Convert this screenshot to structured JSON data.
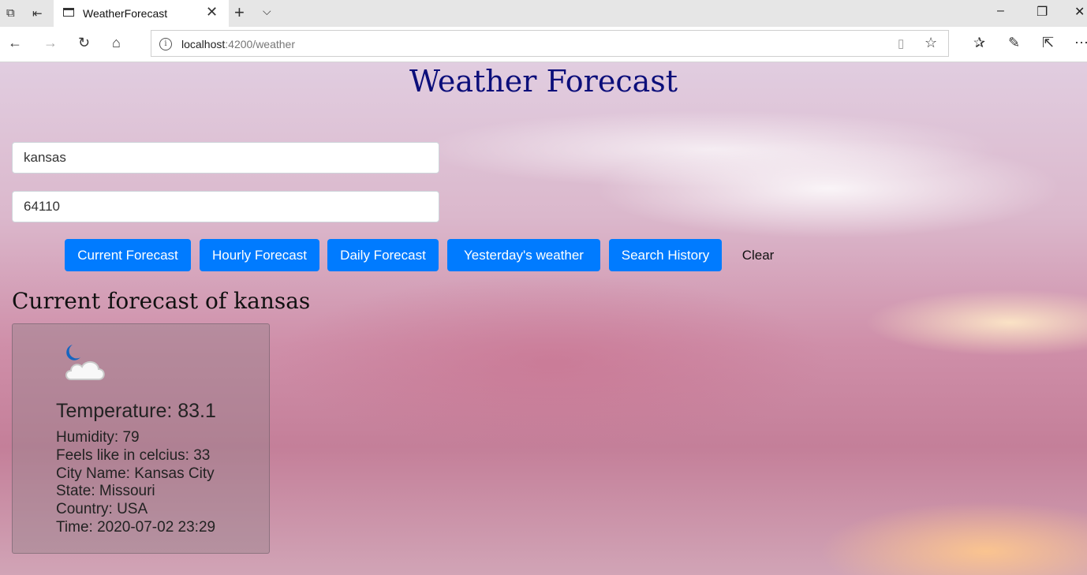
{
  "browser": {
    "tab_title": "WeatherForecast",
    "url_host": "localhost",
    "url_rest": ":4200/weather"
  },
  "page": {
    "title": "Weather Forecast",
    "city_input": {
      "value": "kansas"
    },
    "zip_input": {
      "value": "64110"
    },
    "buttons": {
      "current": "Current Forecast",
      "hourly": "Hourly Forecast",
      "daily": "Daily Forecast",
      "yesterday": "Yesterday's weather",
      "history": "Search History",
      "clear": "Clear"
    },
    "section_heading": "Current forecast of kansas",
    "card": {
      "icon": "night-partly-cloudy-icon",
      "temperature": "Temperature: 83.1",
      "humidity": "Humidity: 79",
      "feels_like": "Feels like in celcius: 33",
      "city": "City Name: Kansas City",
      "state": "State: Missouri",
      "country": "Country: USA",
      "time": "Time: 2020-07-02 23:29"
    }
  },
  "colors": {
    "primary_button": "#007bff",
    "title": "#0b0e7a"
  }
}
